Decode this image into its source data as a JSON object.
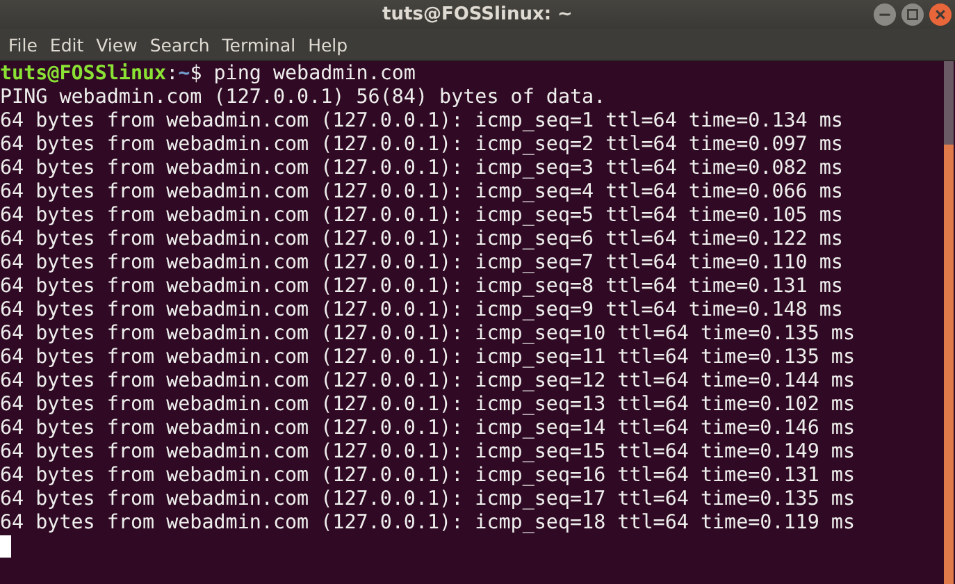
{
  "window": {
    "title": "tuts@FOSSlinux: ~"
  },
  "menu": [
    "File",
    "Edit",
    "View",
    "Search",
    "Terminal",
    "Help"
  ],
  "terminal": {
    "prompt": {
      "user_host": "tuts@FOSSlinux",
      "separator": ":",
      "path": "~",
      "symbol": "$",
      "command": "ping webadmin.com"
    },
    "output": [
      "PING webadmin.com (127.0.0.1) 56(84) bytes of data.",
      "64 bytes from webadmin.com (127.0.0.1): icmp_seq=1 ttl=64 time=0.134 ms",
      "64 bytes from webadmin.com (127.0.0.1): icmp_seq=2 ttl=64 time=0.097 ms",
      "64 bytes from webadmin.com (127.0.0.1): icmp_seq=3 ttl=64 time=0.082 ms",
      "64 bytes from webadmin.com (127.0.0.1): icmp_seq=4 ttl=64 time=0.066 ms",
      "64 bytes from webadmin.com (127.0.0.1): icmp_seq=5 ttl=64 time=0.105 ms",
      "64 bytes from webadmin.com (127.0.0.1): icmp_seq=6 ttl=64 time=0.122 ms",
      "64 bytes from webadmin.com (127.0.0.1): icmp_seq=7 ttl=64 time=0.110 ms",
      "64 bytes from webadmin.com (127.0.0.1): icmp_seq=8 ttl=64 time=0.131 ms",
      "64 bytes from webadmin.com (127.0.0.1): icmp_seq=9 ttl=64 time=0.148 ms",
      "64 bytes from webadmin.com (127.0.0.1): icmp_seq=10 ttl=64 time=0.135 ms",
      "64 bytes from webadmin.com (127.0.0.1): icmp_seq=11 ttl=64 time=0.135 ms",
      "64 bytes from webadmin.com (127.0.0.1): icmp_seq=12 ttl=64 time=0.144 ms",
      "64 bytes from webadmin.com (127.0.0.1): icmp_seq=13 ttl=64 time=0.102 ms",
      "64 bytes from webadmin.com (127.0.0.1): icmp_seq=14 ttl=64 time=0.146 ms",
      "64 bytes from webadmin.com (127.0.0.1): icmp_seq=15 ttl=64 time=0.149 ms",
      "64 bytes from webadmin.com (127.0.0.1): icmp_seq=16 ttl=64 time=0.131 ms",
      "64 bytes from webadmin.com (127.0.0.1): icmp_seq=17 ttl=64 time=0.135 ms",
      "64 bytes from webadmin.com (127.0.0.1): icmp_seq=18 ttl=64 time=0.119 ms"
    ]
  }
}
